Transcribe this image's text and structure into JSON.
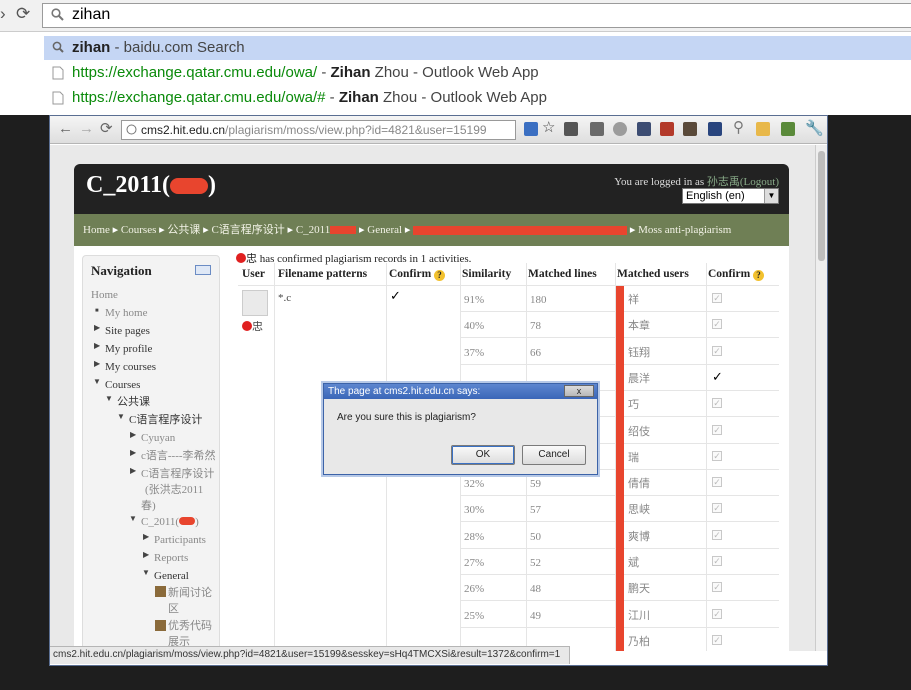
{
  "omnibox": {
    "query": "zihan",
    "suggestions": [
      {
        "bold": "zihan",
        "rest": " - baidu.com Search",
        "url": ""
      },
      {
        "url": "https://exchange.qatar.cmu.edu/owa/",
        "sep": " - ",
        "bold": "Zihan",
        "rest": " Zhou - Outlook Web App"
      },
      {
        "url": "https://exchange.qatar.cmu.edu/owa/#",
        "sep": " - ",
        "bold": "Zihan",
        "rest": " Zhou - Outlook Web App"
      }
    ]
  },
  "inner_browser": {
    "url_host": "cms2.hit.edu.cn",
    "url_path": "/plagiarism/moss/view.php?id=4821&user=15199",
    "status_url": "cms2.hit.edu.cn/plagiarism/moss/view.php?id=4821&user=15199&sesskey=sHq4TMCXSi&result=1372&confirm=1"
  },
  "site": {
    "title": "C_2011(",
    "title_close": ")",
    "logged_in_prefix": "You are logged in as ",
    "logged_in_user": "孙志禹",
    "logout": "(Logout)",
    "language": "English (en)"
  },
  "breadcrumb": [
    "Home",
    "Courses",
    "公共课",
    "C语言程序设计",
    "C_2011",
    "General",
    "Moss anti-plagiarism"
  ],
  "navigation": {
    "title": "Navigation",
    "items": [
      "Home",
      "My home",
      "Site pages",
      "My profile",
      "My courses",
      "Courses",
      "公共课",
      "C语言程序设计",
      "Cyuyan",
      "c语言----李希然",
      "C语言程序设计",
      "(张洪志2011",
      "春)",
      "C_2011(",
      "Participants",
      "Reports",
      "General",
      "新闻讨论",
      "区",
      "优秀代码",
      "展示"
    ]
  },
  "main": {
    "summary_suffix": "忠 has confirmed plagiarism records in 1 activities.",
    "headers": [
      "User",
      "Filename patterns",
      "Confirm",
      "Similarity",
      "Matched lines",
      "Matched users",
      "Confirm"
    ],
    "user_name": "忠",
    "filename": "*.c",
    "rows": [
      {
        "sim": "91%",
        "lines": "180",
        "user": "祥",
        "confirmed": false
      },
      {
        "sim": "40%",
        "lines": "78",
        "user": "本章",
        "confirmed": false
      },
      {
        "sim": "37%",
        "lines": "66",
        "user": "钰翔",
        "confirmed": false
      },
      {
        "sim": "",
        "lines": "",
        "user": "晨洋",
        "confirmed": true
      },
      {
        "sim": "",
        "lines": "",
        "user": "巧",
        "confirmed": false
      },
      {
        "sim": "",
        "lines": "",
        "user": "绍伎",
        "confirmed": false
      },
      {
        "sim": "",
        "lines": "",
        "user": "瑞",
        "confirmed": false
      },
      {
        "sim": "32%",
        "lines": "59",
        "user": "倩倩",
        "confirmed": false
      },
      {
        "sim": "30%",
        "lines": "57",
        "user": "思峡",
        "confirmed": false
      },
      {
        "sim": "28%",
        "lines": "50",
        "user": "爽博",
        "confirmed": false
      },
      {
        "sim": "27%",
        "lines": "52",
        "user": "斌",
        "confirmed": false
      },
      {
        "sim": "26%",
        "lines": "48",
        "user": "鹏天",
        "confirmed": false
      },
      {
        "sim": "25%",
        "lines": "49",
        "user": "江川",
        "confirmed": false
      },
      {
        "sim": "",
        "lines": "",
        "user": "乃柏",
        "confirmed": false
      }
    ]
  },
  "dialog": {
    "title": "The page at cms2.hit.edu.cn says:",
    "close": "x",
    "message": "Are you sure this is plagiarism?",
    "ok": "OK",
    "cancel": "Cancel"
  },
  "colors": {
    "header_bg": "#222222",
    "breadcrumb_bg": "#6f7f55",
    "selected_suggestion": "#c5d6f4",
    "redaction": "#e8452e"
  }
}
